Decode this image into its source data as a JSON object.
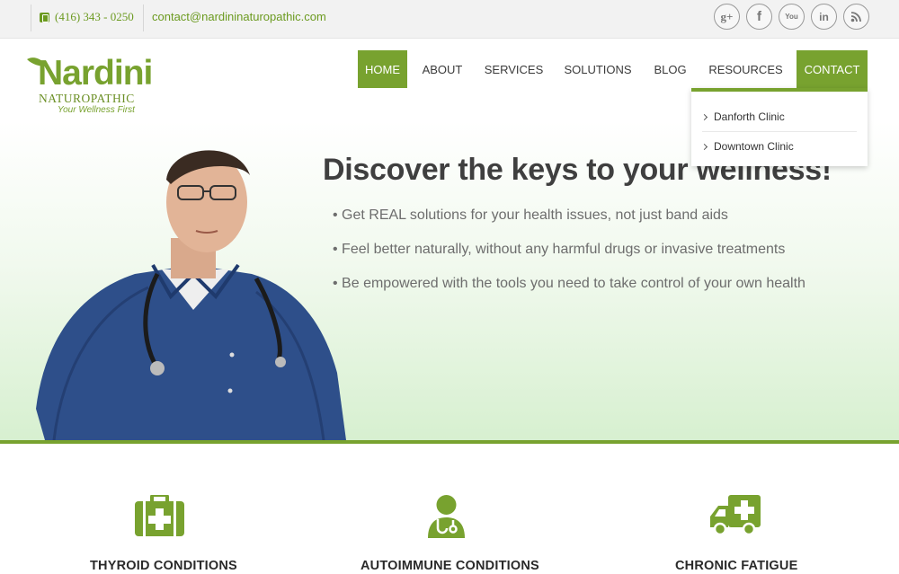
{
  "topbar": {
    "phone": "(416) 343 - 0250",
    "email": "contact@nardininaturopathic.com",
    "social": [
      {
        "icon": "google-plus-icon",
        "label": "g+"
      },
      {
        "icon": "facebook-icon",
        "label": "f"
      },
      {
        "icon": "youtube-icon",
        "label": "You"
      },
      {
        "icon": "linkedin-icon",
        "label": "in"
      },
      {
        "icon": "rss-icon",
        "label": "rss"
      }
    ]
  },
  "logo": {
    "name": "Nardini",
    "sub": "NATUROPATHIC",
    "tagline": "Your Wellness First"
  },
  "nav": {
    "items": [
      "HOME",
      "ABOUT",
      "SERVICES",
      "SOLUTIONS",
      "BLOG",
      "RESOURCES",
      "CONTACT"
    ],
    "active": "HOME"
  },
  "dropdown": {
    "items": [
      "Danforth Clinic",
      "Downtown Clinic"
    ]
  },
  "hero": {
    "headline": "Discover the keys to your wellness!",
    "bullets": [
      "• Get REAL solutions for your health issues, not just band aids",
      "• Feel better naturally, without any harmful drugs or invasive treatments",
      "• Be empowered with the tools you need to take control of your own health"
    ]
  },
  "services": [
    {
      "icon": "first-aid-kit-icon",
      "title": "THYROID CONDITIONS"
    },
    {
      "icon": "doctor-icon",
      "title": "AUTOIMMUNE CONDITIONS"
    },
    {
      "icon": "ambulance-icon",
      "title": "CHRONIC FATIGUE"
    }
  ],
  "colors": {
    "brand_green": "#78a22f",
    "text_dark": "#3f3f3f",
    "topbar_bg": "#f2f2f2"
  }
}
